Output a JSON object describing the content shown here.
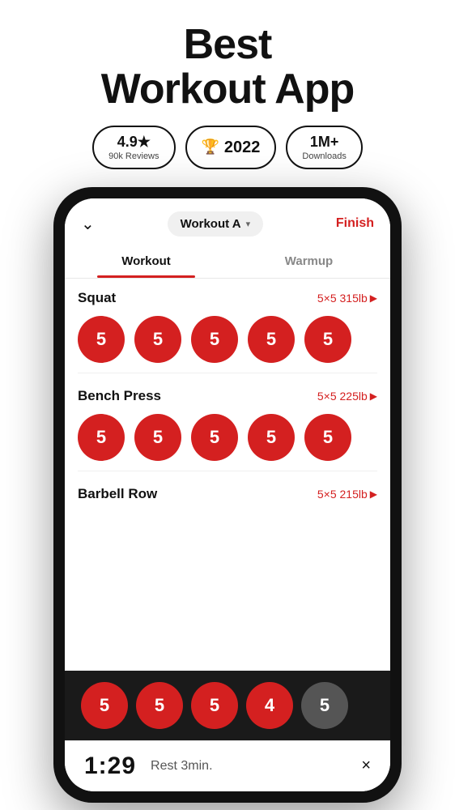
{
  "header": {
    "title": "Best\nWorkout App"
  },
  "badges": [
    {
      "id": "rating",
      "main": "4.9★",
      "sub": "90k Reviews",
      "trophy": false
    },
    {
      "id": "year",
      "main": "2022",
      "sub": null,
      "trophy": true
    },
    {
      "id": "downloads",
      "main": "1M+",
      "sub": "Downloads",
      "trophy": false
    }
  ],
  "app": {
    "chevron": "˅",
    "workout_selector": "Workout A",
    "finish_label": "Finish",
    "tabs": [
      {
        "id": "workout",
        "label": "Workout",
        "active": true
      },
      {
        "id": "warmup",
        "label": "Warmup",
        "active": false
      }
    ],
    "exercises": [
      {
        "id": "squat",
        "name": "Squat",
        "info": "5×5 315lb",
        "sets": [
          5,
          5,
          5,
          5,
          5
        ],
        "set_colors": [
          "red",
          "red",
          "red",
          "red",
          "red"
        ]
      },
      {
        "id": "bench-press",
        "name": "Bench Press",
        "info": "5×5 225lb",
        "sets": [
          5,
          5,
          5,
          5,
          5
        ],
        "set_colors": [
          "red",
          "red",
          "red",
          "red",
          "red"
        ]
      },
      {
        "id": "barbell-row",
        "name": "Barbell Row",
        "info": "5×5 215lb",
        "sets": [],
        "set_colors": []
      }
    ],
    "bottom_sets": [
      {
        "value": 5,
        "color": "red"
      },
      {
        "value": 5,
        "color": "red"
      },
      {
        "value": 5,
        "color": "red"
      },
      {
        "value": 4,
        "color": "red"
      },
      {
        "value": 5,
        "color": "grey"
      }
    ],
    "timer": {
      "display": "1:29",
      "label": "Rest 3min.",
      "close": "×"
    }
  }
}
